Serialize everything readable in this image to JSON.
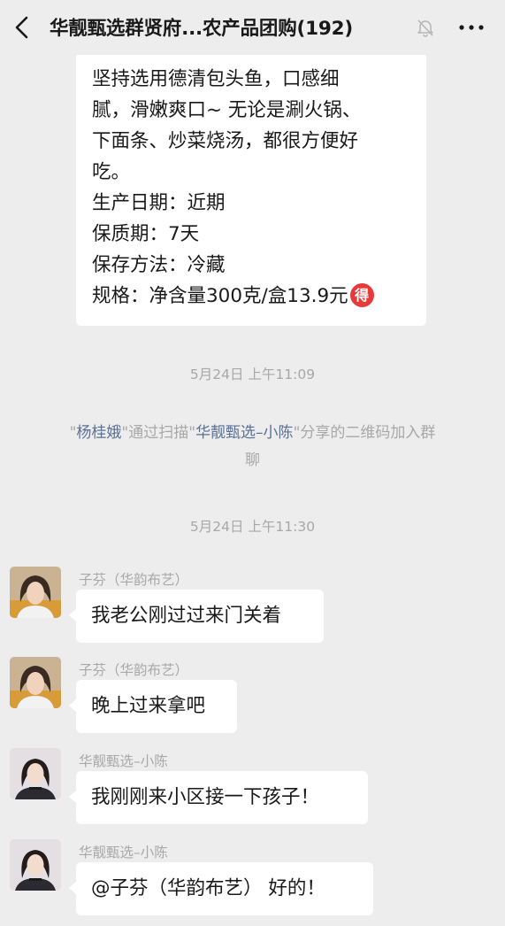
{
  "header": {
    "title": "华靓甄选群贤府...农产品团购(192)",
    "back_icon": "chevron-left-icon",
    "mute_icon": "bell-off-icon",
    "more_icon": "more-horizontal-icon"
  },
  "top_message": {
    "lines": [
      "坚持选用德清包头鱼，口感细",
      "腻，滑嫩爽口~ 无论是涮火锅、",
      "下面条、炒菜烧汤，都很方便好",
      "吃。",
      "生产日期：近期",
      "保质期：7天",
      "保存方法：冷藏",
      "规格：净含量300克/盒13.9元"
    ],
    "badge": "得"
  },
  "timestamp_1": "5月24日 上午11:09",
  "system_message": {
    "q1": "\"",
    "name": "杨桂娥",
    "q2": "\"通过扫描\"",
    "inviter": "华靓甄选–小陈",
    "rest_1": "\"分享的二维码加入群",
    "rest_2": "聊"
  },
  "timestamp_2": "5月24日 上午11:30",
  "messages": [
    {
      "sender": "子芬（华韵布艺）",
      "text": "我老公刚过过来门关着",
      "avatar": "woman-avatar-1"
    },
    {
      "sender": "子芬（华韵布艺）",
      "text": "晚上过来拿吧",
      "avatar": "woman-avatar-1"
    },
    {
      "sender": "华靓甄选–小陈",
      "text": "我刚刚来小区接一下孩子！",
      "avatar": "woman-avatar-2"
    },
    {
      "sender": "华靓甄选–小陈",
      "text": "@子芬（华韵布艺） 好的！",
      "avatar": "woman-avatar-2"
    }
  ],
  "colors": {
    "background": "#ededed",
    "bubble": "#ffffff",
    "meta_text": "#a8a8a8",
    "link_name": "#5a6f95",
    "badge_red": "#e5393a"
  }
}
